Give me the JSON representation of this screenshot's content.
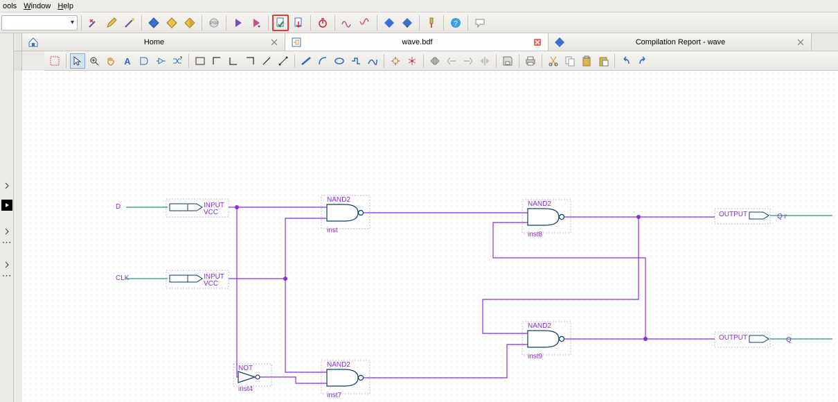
{
  "menu": {
    "tools": "ools",
    "window": "Window",
    "help": "Help"
  },
  "tabs": {
    "home": {
      "label": "Home"
    },
    "active": {
      "label": "wave.bdf"
    },
    "report": {
      "label": "Compilation Report - wave"
    }
  },
  "icons": {
    "toolbar": [
      "wand-x",
      "pencil",
      "wand",
      "diamond-blue",
      "diamond-yellow-1",
      "diamond-yellow-2",
      "stop",
      "play",
      "play-down",
      "page-check",
      "page-out",
      "timer",
      "waves-1",
      "waves-2",
      "diamond-solid",
      "diamond-down",
      "probe",
      "help",
      "comment"
    ],
    "editor": [
      "rect-sel",
      "pointer",
      "zoom-plus",
      "hand",
      "text-A",
      "text-D",
      "buffer",
      "bus",
      "rect-empty",
      "corner-tl",
      "wire-L",
      "wire-7",
      "diag",
      "diag-dot",
      "line-thick",
      "arc",
      "ellipse",
      "poly",
      "curve",
      "target",
      "net",
      "flip-h",
      "align-l",
      "align-r",
      "mirror",
      "save",
      "print",
      "cut",
      "copy",
      "paste",
      "paste-sp",
      "undo",
      "redo"
    ]
  },
  "schematic": {
    "inputs": {
      "d": {
        "label": "D",
        "type": "INPUT",
        "sub": "VCC"
      },
      "clk": {
        "label": "CLK",
        "type": "INPUT",
        "sub": "VCC"
      }
    },
    "outputs": {
      "q": {
        "label": "Q",
        "type": "OUTPUT"
      },
      "qr": {
        "label": "Q  r",
        "type": "OUTPUT"
      }
    },
    "gates": {
      "nand_tl": {
        "type": "NAND2",
        "inst": "inst"
      },
      "nand_bl": {
        "type": "NAND2",
        "inst": "inst7"
      },
      "nand_tr": {
        "type": "NAND2",
        "inst": "inst8"
      },
      "nand_br": {
        "type": "NAND2",
        "inst": "inst9"
      },
      "not": {
        "type": "NOT",
        "inst": "inst4"
      }
    }
  }
}
